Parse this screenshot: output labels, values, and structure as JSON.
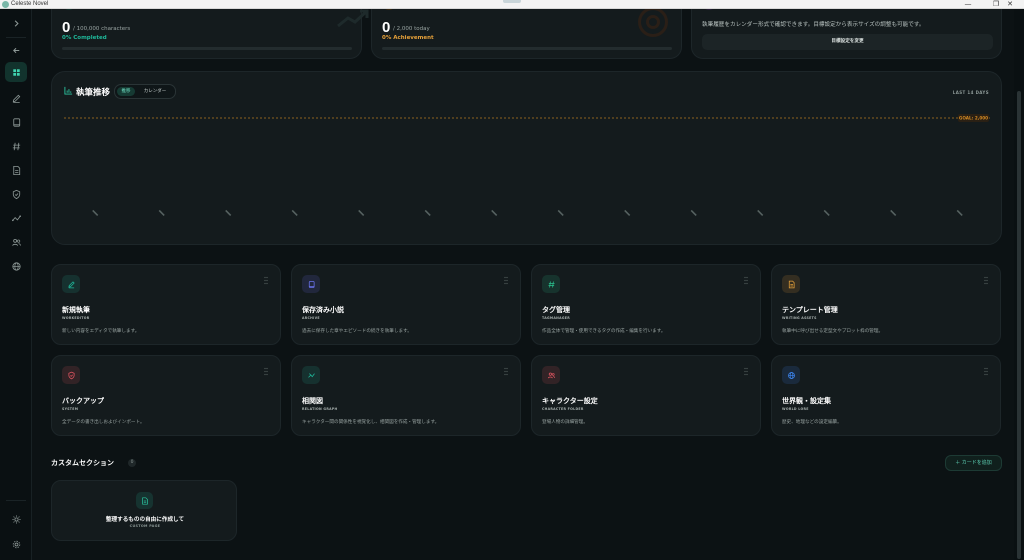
{
  "window": {
    "title": "Celeste Novel",
    "minimize": "—",
    "maximize": "❐",
    "close": "✕"
  },
  "stats": {
    "characters": {
      "value": "0",
      "unit": "/ 100,000 characters",
      "percent_label": "0% Completed",
      "progress": 0.0
    },
    "today": {
      "value": "0",
      "unit": "/ 2,000 today",
      "percent_label": "0% Achievement",
      "progress": 0.0
    },
    "history": {
      "description": "執筆履歴をカレンダー形式で確認できます。目標設定から表示サイズの調整も可能です。",
      "button": "目標設定を変更"
    }
  },
  "chart": {
    "title": "執筆推移",
    "toggle": [
      "推移",
      "カレンダー"
    ],
    "range_label": "LAST 14 DAYS",
    "goal_label": "GOAL: 2,000"
  },
  "chart_data": {
    "type": "line",
    "title": "執筆推移",
    "x": [
      "",
      "",
      "",
      "",
      "",
      "",
      "",
      "",
      "",
      "",
      "",
      "",
      "",
      ""
    ],
    "series": [],
    "goal": 2000,
    "legend": "none",
    "grid": false
  },
  "tiles": [
    {
      "title": "新規執筆",
      "subtitle": "WORKEDITOR",
      "description": "新しい内容をエディタで執筆します。",
      "icon": "pencil-icon",
      "color": "#1fb89a"
    },
    {
      "title": "保存済み小説",
      "subtitle": "ARCHIVE",
      "description": "過去に保存した章やエピソードの続きを執筆します。",
      "icon": "book-icon",
      "color": "#6b74f0"
    },
    {
      "title": "タグ管理",
      "subtitle": "TAGMANAGER",
      "description": "作品全体で管理・使用できるタグの作成・編集を行います。",
      "icon": "hash-icon",
      "color": "#2bc48f"
    },
    {
      "title": "テンプレート管理",
      "subtitle": "WRITING ASSETS",
      "description": "執筆中に呼び出せる定型文やプロット枠の管理。",
      "icon": "document-icon",
      "color": "#e8a23a"
    },
    {
      "title": "バックアップ",
      "subtitle": "SYSTEM",
      "description": "全データの書き出しおよびインポート。",
      "icon": "shield-icon",
      "color": "#e05561"
    },
    {
      "title": "相関図",
      "subtitle": "RELATION GRAPH",
      "description": "キャラクター間の関係性を視覚化し、相関図を作成・管理します。",
      "icon": "graph-icon",
      "color": "#1fb89a"
    },
    {
      "title": "キャラクター設定",
      "subtitle": "CHARACTER FOLDER",
      "description": "登場人物の詳細管理。",
      "icon": "people-icon",
      "color": "#e05561"
    },
    {
      "title": "世界観・設定集",
      "subtitle": "WORLD LORE",
      "description": "歴史、地理などの設定編纂。",
      "icon": "globe-icon",
      "color": "#3d86f0"
    }
  ],
  "custom_section": {
    "title": "カスタムセクション",
    "count": "0",
    "add_button": "＋ カードを追加",
    "card": {
      "title": "整理するものの自由に作成して",
      "subtitle": "CUSTOM PAGE"
    }
  },
  "sidebar": {
    "items": [
      "chevron-right-icon",
      "back-arrow-icon",
      "dashboard-icon",
      "pencil-icon",
      "book-icon",
      "hash-icon",
      "document-icon",
      "shield-icon",
      "graph-icon",
      "people-icon",
      "globe-icon",
      "sun-icon",
      "gear-icon"
    ]
  },
  "colors": {
    "accent": "#1fb89a",
    "warning": "#e8a23a",
    "background": "#0c1214",
    "card": "#141b1d"
  }
}
